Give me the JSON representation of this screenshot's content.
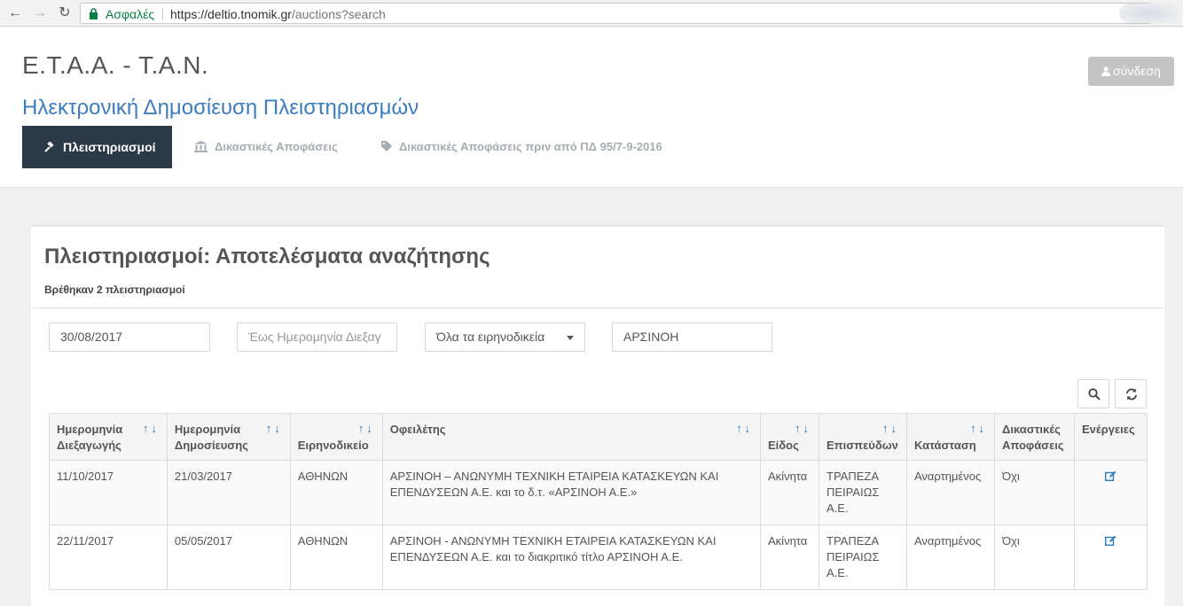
{
  "browser": {
    "secure_label": "Ασφαλές",
    "url_host": "https://deltio.tnomik.gr",
    "url_path": "/auctions?search"
  },
  "header": {
    "title": "E.T.A.A. - T.A.N.",
    "subtitle": "Ηλεκτρονική Δημοσίευση Πλειστηριασμών",
    "login_label": "σύνδεση",
    "tabs": [
      {
        "label": "Πλειστηριασμοί",
        "icon": "gavel-icon",
        "active": true
      },
      {
        "label": "Δικαστικές Αποφάσεις",
        "icon": "bank-icon",
        "active": false
      },
      {
        "label": "Δικαστικές Αποφάσεις πριν από ΠΔ 95/7-9-2016",
        "icon": "tag-icon",
        "active": false
      }
    ]
  },
  "panel": {
    "title": "Πλειστηριασμοί: Αποτελέσματα αναζήτησης",
    "count_text": "Βρέθηκαν 2 πλειστηριασμοί"
  },
  "filters": {
    "date_from": "30/08/2017",
    "date_to_placeholder": "Έως Ημερομηνία Διεξαγ",
    "court_selected": "Όλα τα ειρηνοδικεία",
    "debtor": "ΑΡΣΙΝΟΗ"
  },
  "table": {
    "columns": [
      {
        "line1": "Ημερομηνία",
        "line2": "Διεξαγωγής",
        "sortable": true
      },
      {
        "line1": "Ημερομηνία",
        "line2": "Δημοσίευσης",
        "sortable": true
      },
      {
        "line1": "",
        "line2": "Ειρηνοδικείο",
        "sortable": true
      },
      {
        "line1": "Οφειλέτης",
        "line2": "",
        "sortable": true
      },
      {
        "line1": "",
        "line2": "Είδος",
        "sortable": true
      },
      {
        "line1": "",
        "line2": "Επισπεύδων",
        "sortable": true
      },
      {
        "line1": "",
        "line2": "Κατάσταση",
        "sortable": true
      },
      {
        "line1": "Δικαστικές",
        "line2": "Αποφάσεις",
        "sortable": false
      },
      {
        "line1": "Ενέργειες",
        "line2": "",
        "sortable": false
      }
    ],
    "rows": [
      {
        "date_held": "11/10/2017",
        "date_published": "21/03/2017",
        "court": "ΑΘΗΝΩΝ",
        "debtor": "ΑΡΣΙΝΟΗ – ΑΝΩΝΥΜΗ ΤΕΧΝΙΚΗ ΕΤΑΙΡΕΙΑ ΚΑΤΑΣΚΕΥΩΝ ΚΑΙ ΕΠΕΝΔΥΣΕΩΝ Α.Ε. και το δ.τ. «ΑΡΣΙΝΟΗ Α.Ε.»",
        "type": "Ακίνητα",
        "petitioner": "ΤΡΑΠΕΖΑ ΠΕΙΡΑΙΩΣ Α.Ε.",
        "status": "Αναρτημένος",
        "decisions": "Όχι"
      },
      {
        "date_held": "22/11/2017",
        "date_published": "05/05/2017",
        "court": "ΑΘΗΝΩΝ",
        "debtor": "ΑΡΣΙΝΟΗ - ΑΝΩΝΥΜΗ ΤΕΧΝΙΚΗ ΕΤΑΙΡΕΙΑ ΚΑΤΑΣΚΕΥΩΝ ΚΑΙ ΕΠΕΝΔΥΣΕΩΝ Α.Ε. και το διακριτικό τίτλο ΑΡΣΙΝΟΗ Α.Ε.",
        "type": "Ακίνητα",
        "petitioner": "ΤΡΑΠΕΖΑ ΠΕΙΡΑΙΩΣ Α.Ε.",
        "status": "Αναρτημένος",
        "decisions": "Όχι"
      }
    ]
  },
  "colors": {
    "accent": "#3c7dbf",
    "nav_dark": "#2c3a48",
    "sort_arrow": "#2a7ab8",
    "secure_green": "#0b8043"
  }
}
